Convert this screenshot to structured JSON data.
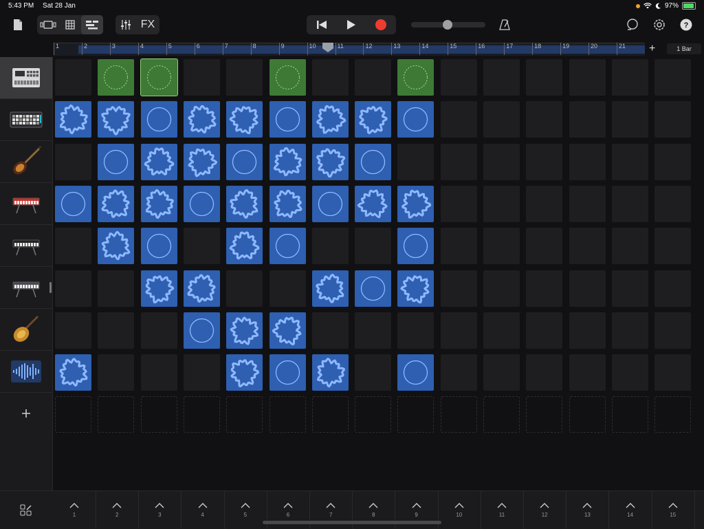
{
  "status": {
    "time": "5:43 PM",
    "date": "Sat 28 Jan",
    "battery": "97%"
  },
  "toolbar": {
    "fx_label": "FX"
  },
  "ruler": {
    "ticks": [
      "1",
      "2",
      "3",
      "4",
      "5",
      "6",
      "7",
      "8",
      "9",
      "10",
      "11",
      "12",
      "13",
      "14",
      "15",
      "16",
      "17",
      "18",
      "19",
      "20",
      "21"
    ],
    "bar_select": "1 Bar",
    "playhead_bar": 10
  },
  "tracks": [
    {
      "name": "drum-machine",
      "icon": "drum-machine-icon",
      "selected": true
    },
    {
      "name": "beat-sequencer",
      "icon": "sequencer-icon",
      "selected": false
    },
    {
      "name": "bass-guitar",
      "icon": "bass-guitar-icon",
      "selected": false
    },
    {
      "name": "red-keyboard",
      "icon": "keyboard-icon",
      "selected": false
    },
    {
      "name": "synth-keyboard",
      "icon": "keyboard-icon",
      "selected": false
    },
    {
      "name": "workstation-keyboard",
      "icon": "keyboard-icon",
      "selected": false
    },
    {
      "name": "electric-guitar",
      "icon": "guitar-icon",
      "selected": false
    },
    {
      "name": "audio-recorder",
      "icon": "waveform-icon",
      "selected": false
    }
  ],
  "grid": {
    "columns": 15,
    "rows": [
      [
        "",
        "g",
        "G",
        "",
        "",
        "g",
        "",
        "",
        "g",
        "",
        "",
        "",
        "",
        "",
        ""
      ],
      [
        "b",
        "b",
        "b",
        "b",
        "b",
        "b",
        "b",
        "b",
        "b",
        "",
        "",
        "",
        "",
        "",
        ""
      ],
      [
        "",
        "b",
        "b",
        "b",
        "b",
        "b",
        "b",
        "b",
        "",
        "",
        "",
        "",
        "",
        "",
        ""
      ],
      [
        "b",
        "b",
        "b",
        "b",
        "b",
        "b",
        "b",
        "b",
        "b",
        "",
        "",
        "",
        "",
        "",
        ""
      ],
      [
        "",
        "b",
        "b",
        "",
        "b",
        "b",
        "",
        "",
        "b",
        "",
        "",
        "",
        "",
        "",
        ""
      ],
      [
        "",
        "",
        "b",
        "b",
        "",
        "",
        "b",
        "b",
        "b",
        "",
        "",
        "",
        "",
        "",
        ""
      ],
      [
        "",
        "",
        "",
        "b",
        "b",
        "b",
        "",
        "",
        "",
        "",
        "",
        "",
        "",
        "",
        ""
      ],
      [
        "b",
        "",
        "",
        "",
        "b",
        "b",
        "b",
        "",
        "b",
        "",
        "",
        "",
        "",
        "",
        ""
      ]
    ]
  },
  "columns": [
    "1",
    "2",
    "3",
    "4",
    "5",
    "6",
    "7",
    "8",
    "9",
    "10",
    "11",
    "12",
    "13",
    "14",
    "15"
  ],
  "colors": {
    "blue": "#2e5fb0",
    "green": "#3e7a35",
    "record": "#f03c30"
  }
}
